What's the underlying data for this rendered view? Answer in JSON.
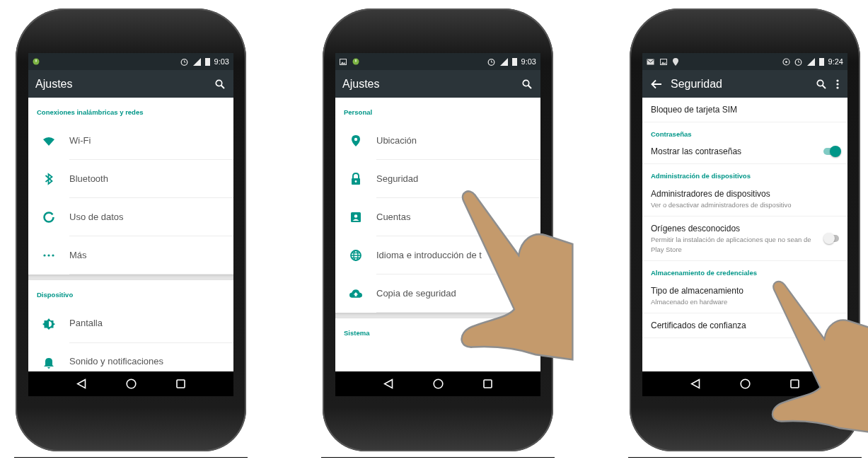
{
  "phones": [
    {
      "status_bar": {
        "time": "9:03"
      },
      "app_bar": {
        "title": "Ajustes",
        "back_button": false,
        "overflow_menu": false
      },
      "pointer_hand": false,
      "sections": [
        {
          "header": "Conexiones inalámbricas y redes",
          "items": [
            {
              "label": "Wi-Fi",
              "kind": "wifi"
            },
            {
              "label": "Bluetooth",
              "kind": "bluetooth"
            },
            {
              "label": "Uso de datos",
              "kind": "data"
            },
            {
              "label": "Más",
              "kind": "more"
            }
          ]
        },
        {
          "header": "Dispositivo",
          "items": [
            {
              "label": "Pantalla",
              "kind": "display"
            },
            {
              "label": "Sonido y notificaciones",
              "kind": "bell"
            }
          ]
        }
      ]
    },
    {
      "status_bar": {
        "time": "9:03"
      },
      "app_bar": {
        "title": "Ajustes",
        "back_button": false,
        "overflow_menu": false
      },
      "pointer_hand": true,
      "sections": [
        {
          "header": "Personal",
          "items": [
            {
              "label": "Ubicación",
              "kind": "pin"
            },
            {
              "label": "Seguridad",
              "kind": "lock"
            },
            {
              "label": "Cuentas",
              "kind": "account"
            },
            {
              "label": "Idioma e introducción de t",
              "kind": "globe"
            },
            {
              "label": "Copia de seguridad",
              "kind": "cloud"
            }
          ]
        },
        {
          "header": "Sistema"
        }
      ]
    },
    {
      "status_bar": {
        "time": "9:24"
      },
      "app_bar": {
        "title": "Seguridad",
        "back_button": true,
        "overflow_menu": true
      },
      "pointer_hand": true,
      "sections": [
        {
          "items": [
            {
              "label": "Bloqueo de tarjeta SIM",
              "kind": "plain"
            }
          ]
        },
        {
          "header": "Contraseñas",
          "items": [
            {
              "label": "Mostrar las contraseñas",
              "kind": "switch",
              "switch_on": true
            }
          ]
        },
        {
          "header": "Administración de dispositivos",
          "items": [
            {
              "label": "Administradores de dispositivos",
              "kind": "plain",
              "subtitle": "Ver o desactivar administradores de dispositivo"
            },
            {
              "label": "Orígenes desconocidos",
              "kind": "switch",
              "subtitle": "Permitir la instalación de aplicaciones que no sean de Play Store",
              "switch_on": false
            }
          ]
        },
        {
          "header": "Almacenamiento de credenciales",
          "items": [
            {
              "label": "Tipo de almacenamiento",
              "kind": "plain",
              "subtitle": "Almacenado en hardware"
            },
            {
              "label": "Certificados de confianza",
              "kind": "plain"
            }
          ]
        }
      ]
    }
  ]
}
